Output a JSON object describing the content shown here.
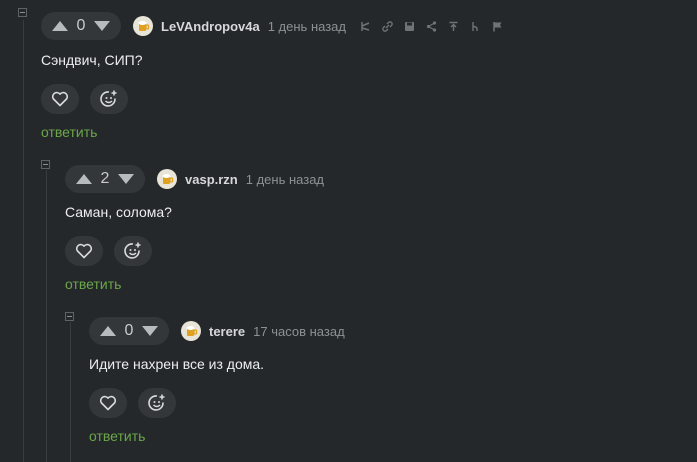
{
  "comments": [
    {
      "votes": "0",
      "username": "LeVAndropov4a",
      "time": "1 день назад",
      "text": "Сэндвич, СИП?",
      "reply": "ответить",
      "tools": [
        "branch-icon",
        "link-icon",
        "save-icon",
        "share-icon",
        "parent-icon",
        "thread-icon",
        "report-icon"
      ]
    },
    {
      "votes": "2",
      "username": "vasp.rzn",
      "time": "1 день назад",
      "text": "Саман, солома?",
      "reply": "ответить"
    },
    {
      "votes": "0",
      "username": "terere",
      "time": "17 часов назад",
      "text": "Идите нахрен все из дома.",
      "reply": "ответить"
    }
  ],
  "colors": {
    "background": "#25282a",
    "pill": "#343739",
    "reply": "#6ba64a",
    "time": "#8d9194"
  }
}
